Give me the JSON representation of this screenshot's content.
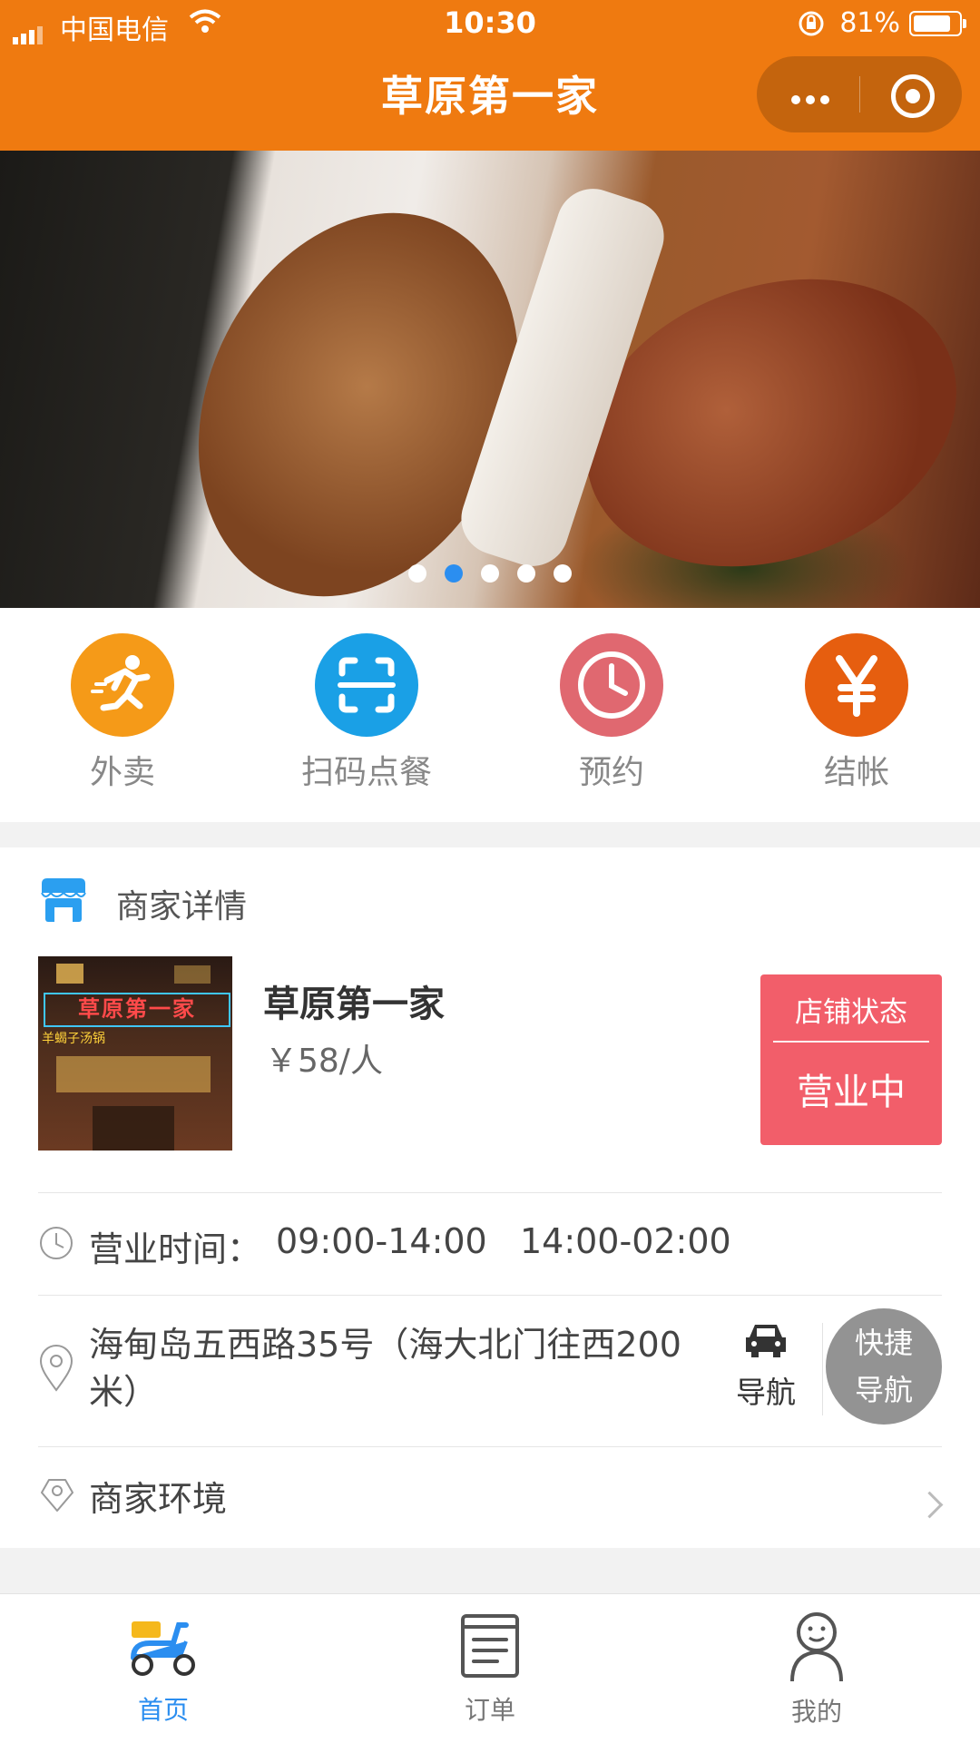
{
  "status_bar": {
    "carrier": "中国电信",
    "time": "10:30",
    "battery": "81%"
  },
  "nav": {
    "title": "草原第一家"
  },
  "banner": {
    "slide_count": 5,
    "active_slide": 2
  },
  "quick_menu": [
    {
      "label": "外卖",
      "icon": "running-man-icon",
      "color": "#f59a18"
    },
    {
      "label": "扫码点餐",
      "icon": "scan-icon",
      "color": "#1aa0e6"
    },
    {
      "label": "预约",
      "icon": "clock-icon",
      "color": "#e06870"
    },
    {
      "label": "结帐",
      "icon": "yen-icon",
      "color": "#e65e0f"
    }
  ],
  "merchant": {
    "section_title": "商家详情",
    "name": "草原第一家",
    "price": "￥58/人",
    "store_status_label": "店铺状态",
    "store_status": "营业中",
    "hours_label": "营业时间：",
    "hours": "09:00-14:00   14:00-02:00",
    "address": "海甸岛五西路35号（海大北门往西200米）",
    "nav_label": "导航",
    "fab_label_1": "快捷",
    "fab_label_2": "导航",
    "environment_label": "商家环境",
    "thumb_sign": "草原第一家",
    "thumb_subsign": "羊蝎子汤锅"
  },
  "tabbar": [
    {
      "label": "首页",
      "icon": "scooter-icon",
      "active": true
    },
    {
      "label": "订单",
      "icon": "order-list-icon",
      "active": false
    },
    {
      "label": "我的",
      "icon": "person-icon",
      "active": false
    }
  ]
}
